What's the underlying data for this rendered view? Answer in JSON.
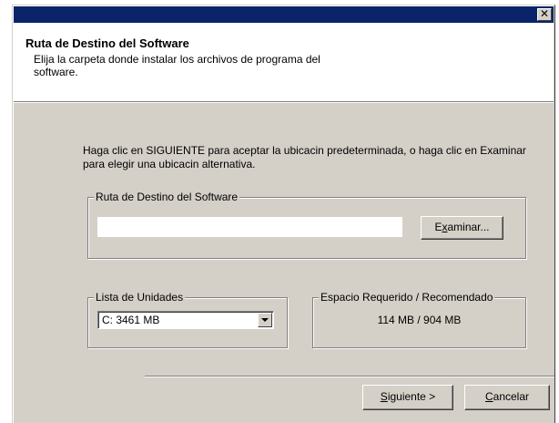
{
  "window": {
    "close_symbol": "✕"
  },
  "header": {
    "title": "Ruta de Destino del Software",
    "subtitle": "Elija la carpeta donde instalar los archivos de programa del software."
  },
  "intro": "Haga clic en SIGUIENTE para aceptar la ubicacin predeterminada, o haga clic en Examinar para elegir una ubicacin alternativa.",
  "dest_group": {
    "legend": "Ruta de Destino del Software",
    "path_value": "",
    "browse_button": {
      "prefix": "E",
      "hotkey": "x",
      "rest": "aminar..."
    }
  },
  "drives_group": {
    "legend": "Lista de Unidades",
    "selected": "C:   3461 MB"
  },
  "space_group": {
    "legend": "Espacio Requerido / Recomendado",
    "value": "114 MB / 904 MB"
  },
  "footer": {
    "next_button": {
      "hotkey": "S",
      "rest": "iguiente >"
    },
    "cancel_button": {
      "hotkey": "C",
      "rest": "ancelar"
    }
  }
}
